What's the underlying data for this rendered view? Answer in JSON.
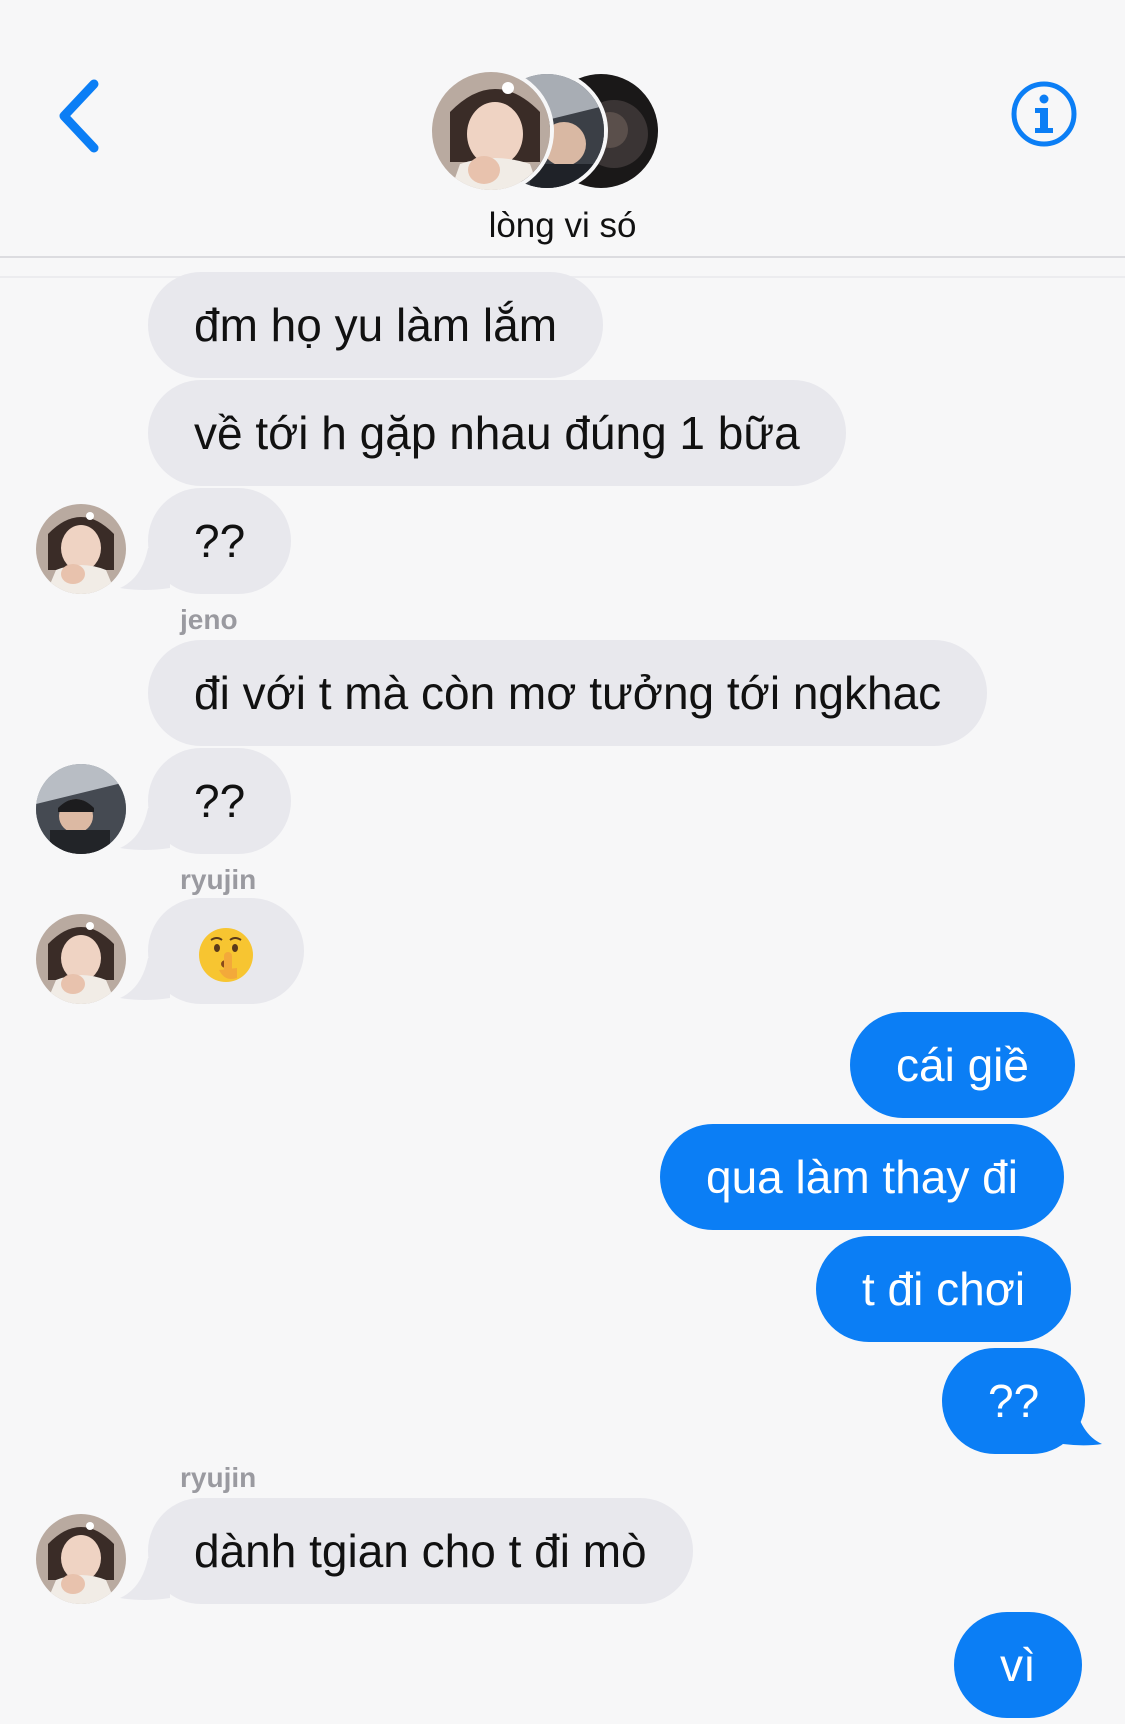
{
  "header": {
    "title": "lòng vi só",
    "back_icon": "chevron-left-icon",
    "info_icon": "info-icon",
    "accent": "#0b7ef5"
  },
  "messages": [
    {
      "dir": "in",
      "text": "đm họ yu làm lắm"
    },
    {
      "dir": "in",
      "text": "về tới h gặp nhau đúng 1 bữa"
    },
    {
      "dir": "in",
      "text": "??"
    },
    {
      "dir": "sender",
      "text": "jeno"
    },
    {
      "dir": "in",
      "text": "đi với t mà còn mơ tưởng tới ngkhac"
    },
    {
      "dir": "in",
      "text": "??"
    },
    {
      "dir": "sender",
      "text": "ryujin"
    },
    {
      "dir": "in",
      "emoji": "shushing-face-emoji"
    },
    {
      "dir": "out",
      "text": "cái giề"
    },
    {
      "dir": "out",
      "text": "qua làm thay đi"
    },
    {
      "dir": "out",
      "text": "t đi chơi"
    },
    {
      "dir": "out",
      "text": "??"
    },
    {
      "dir": "sender",
      "text": "ryujin"
    },
    {
      "dir": "in",
      "text": "dành tgian cho t đi mò"
    },
    {
      "dir": "out",
      "text": "vì"
    }
  ],
  "colors": {
    "incoming_bubble": "#e8e8ed",
    "outgoing_bubble": "#0b7ef5",
    "background": "#f7f7f8",
    "sender_label": "#9a9aa0"
  }
}
